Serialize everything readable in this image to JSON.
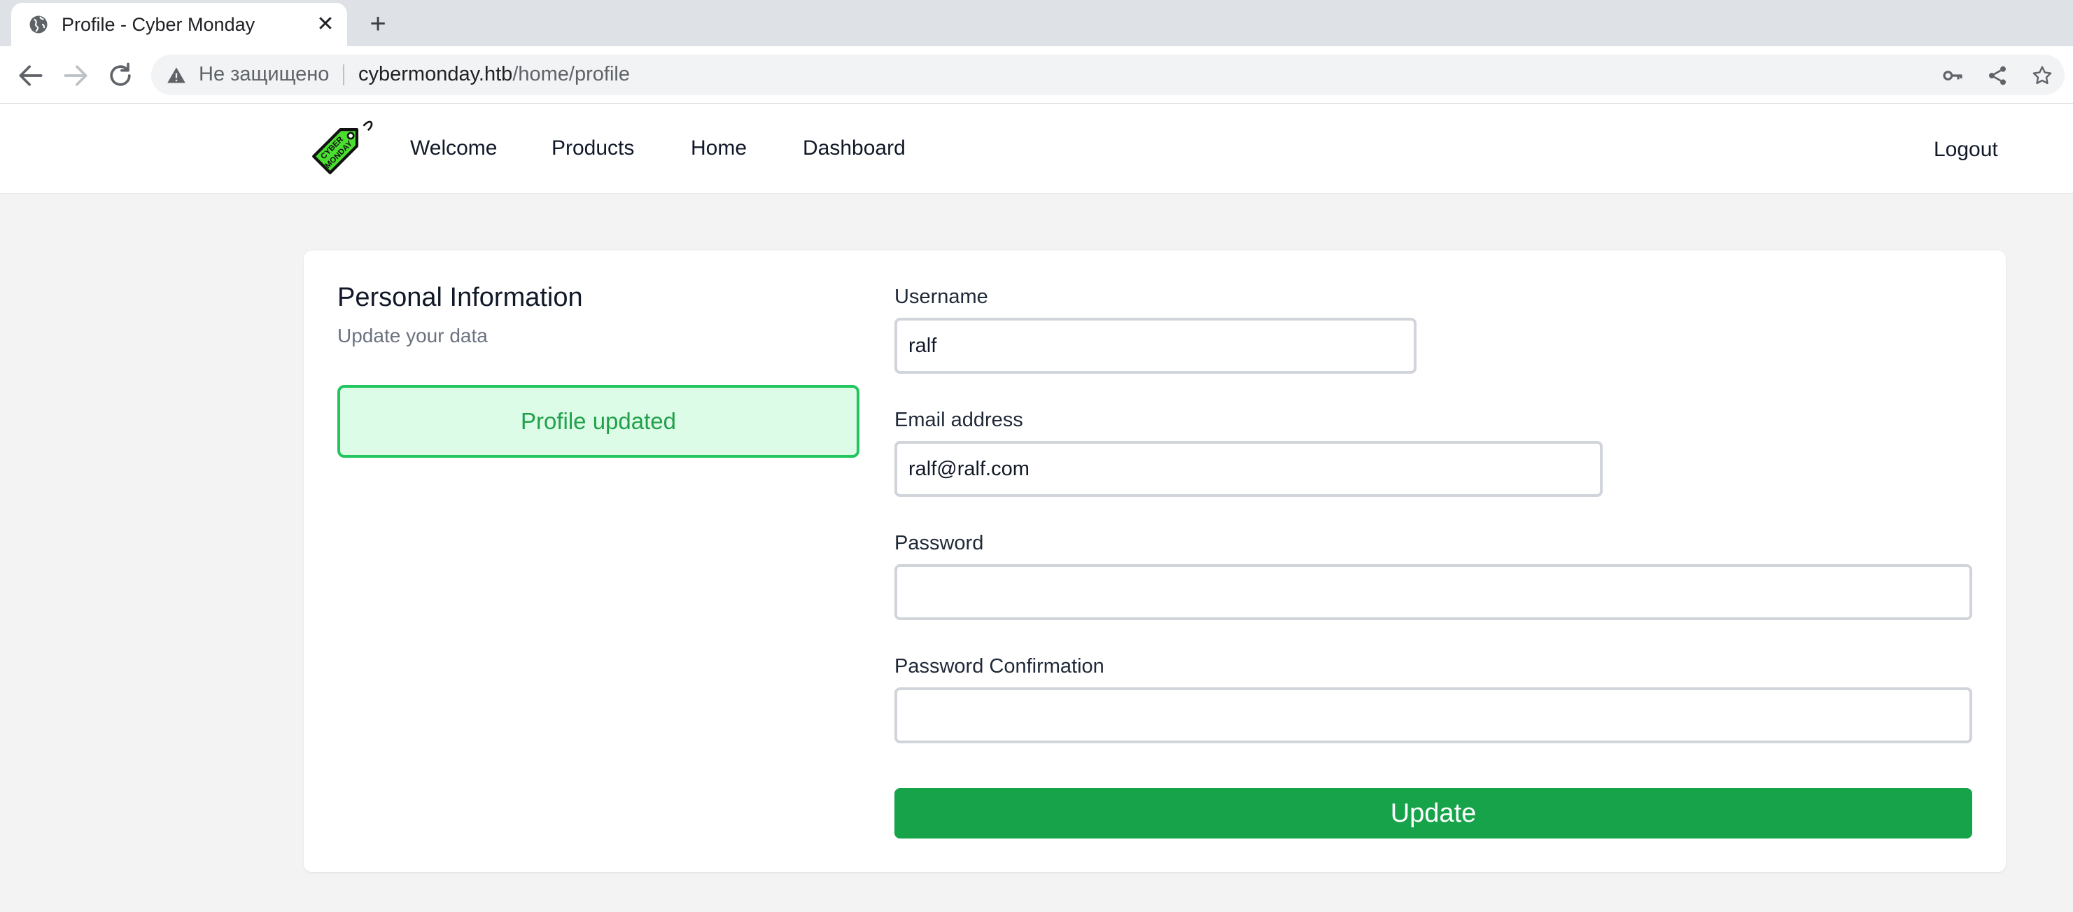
{
  "browser": {
    "tab_title": "Profile - Cyber Monday",
    "security_text": "Не защищено",
    "url_host": "cybermonday.htb",
    "url_path": "/home/profile"
  },
  "site": {
    "logo_text": "CYBER MONDAY",
    "nav": [
      "Welcome",
      "Products",
      "Home",
      "Dashboard"
    ],
    "logout": "Logout"
  },
  "profile": {
    "title": "Personal Information",
    "subtitle": "Update your data",
    "alert": "Profile updated",
    "fields": {
      "username": {
        "label": "Username",
        "value": "ralf"
      },
      "email": {
        "label": "Email address",
        "value": "ralf@ralf.com"
      },
      "password": {
        "label": "Password",
        "value": ""
      },
      "password_confirmation": {
        "label": "Password Confirmation",
        "value": ""
      }
    },
    "submit": "Update"
  },
  "colors": {
    "accent": "#16a34a",
    "alert_bg": "#dcfce7",
    "alert_border": "#22c55e",
    "logo_green": "#4ade30"
  }
}
